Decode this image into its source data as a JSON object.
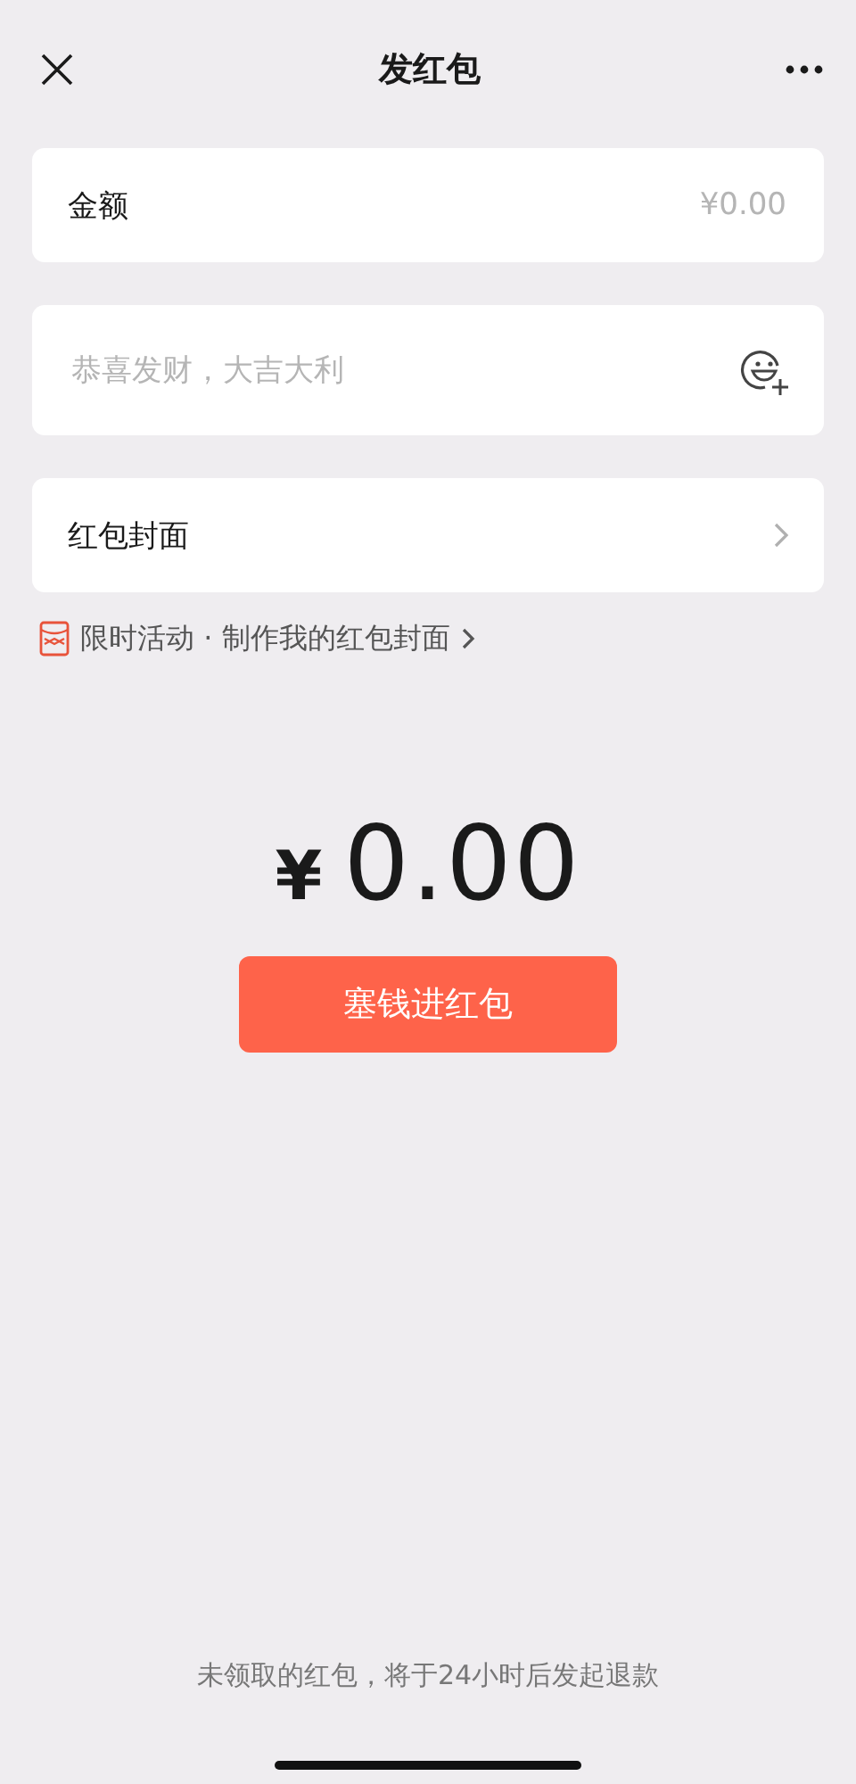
{
  "header": {
    "title": "发红包"
  },
  "amount_field": {
    "label": "金额",
    "placeholder": "¥0.00"
  },
  "message_field": {
    "placeholder": "恭喜发财，大吉大利"
  },
  "cover_row": {
    "label": "红包封面"
  },
  "promo_link": {
    "text": "限时活动 · 制作我的红包封面"
  },
  "total": {
    "currency": "¥",
    "amount": "0.00"
  },
  "submit_button": {
    "label": "塞钱进红包"
  },
  "footer_note": "未领取的红包，将于24小时后发起退款"
}
